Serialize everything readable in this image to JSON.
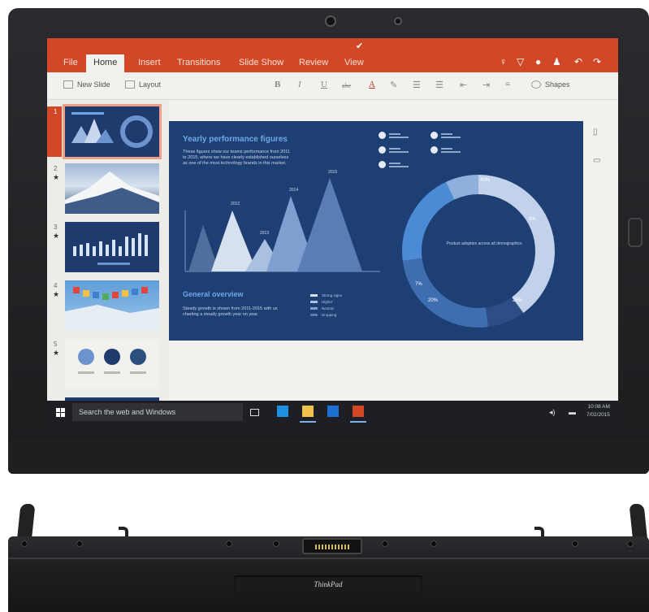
{
  "ribbon": {
    "tabs": [
      "File",
      "Home",
      "Insert",
      "Transitions",
      "Slide Show",
      "Review",
      "View"
    ],
    "active_tab": "Home",
    "accent_color": "#d24726"
  },
  "toolbar": {
    "new_slide": "New Slide",
    "layout": "Layout",
    "bold": "B",
    "italic": "I",
    "underline": "U",
    "strike": "abc",
    "font_color": "A",
    "shapes": "Shapes"
  },
  "thumbnails": [
    {
      "num": "1",
      "star": ""
    },
    {
      "num": "2",
      "star": "★"
    },
    {
      "num": "3",
      "star": "★"
    },
    {
      "num": "4",
      "star": "★"
    },
    {
      "num": "5",
      "star": "★"
    }
  ],
  "slide": {
    "title": "Yearly performance figures",
    "intro": "These figures show our teams performance from 2011 to 2015, where we have clearly established ourselves as one of the most technology brands in this market.",
    "subtitle": "General overview",
    "overview": "Steady growth is shown from 2011-2015 with us charting a steady growth year on year.",
    "legend": [
      "Strong signs",
      "Higher",
      "Neutral",
      "Dropping"
    ],
    "peak_labels": [
      "2012",
      "2013",
      "2014",
      "2015"
    ],
    "donut_center": "Product adoption across all demographics",
    "donut_labels": [
      "40%",
      "8%",
      "25%",
      "20%",
      "7%"
    ]
  },
  "taskbar": {
    "search_placeholder": "Search the web and Windows",
    "time": "10:08 AM",
    "date": "7/02/2015"
  },
  "dock": {
    "brand": "ThinkPad"
  }
}
